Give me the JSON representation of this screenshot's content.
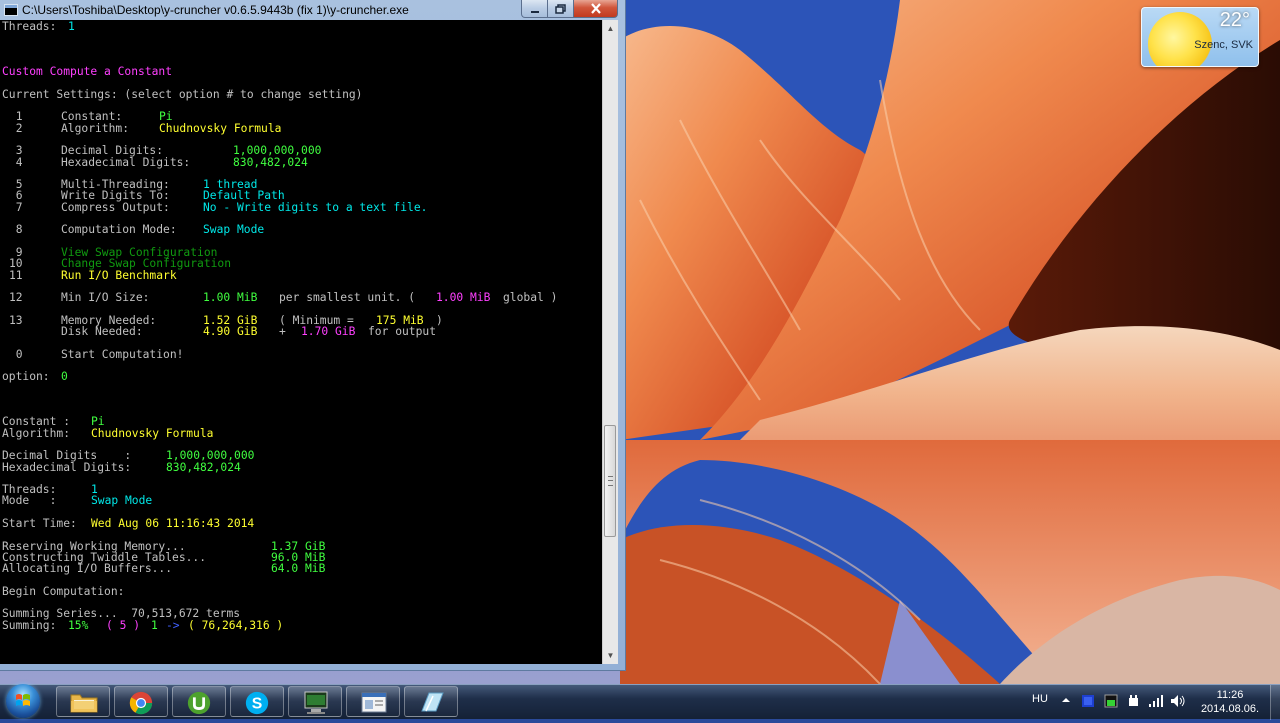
{
  "window": {
    "title": "C:\\Users\\Toshiba\\Desktop\\y-cruncher v0.6.5.9443b (fix 1)\\y-cruncher.exe",
    "minimize_icon": "minimize-icon",
    "maximize_icon": "maximize-icon",
    "close_icon": "close-icon"
  },
  "console": {
    "threads_top": "Threads: ",
    "threads_top_val": "1",
    "menu_title": "Custom Compute a Constant",
    "current_settings": "Current Settings: (select option # to change setting)",
    "opt1": {
      "num": " 1",
      "label": "Constant:",
      "value": "Pi"
    },
    "opt2": {
      "num": " 2",
      "label": "Algorithm:",
      "value": "Chudnovsky Formula"
    },
    "opt3": {
      "num": " 3",
      "label": "Decimal Digits:",
      "value": "1,000,000,000"
    },
    "opt4": {
      "num": " 4",
      "label": "Hexadecimal Digits:",
      "value": "830,482,024"
    },
    "opt5": {
      "num": " 5",
      "label": "Multi-Threading:",
      "value": "1 thread"
    },
    "opt6": {
      "num": " 6",
      "label": "Write Digits To:",
      "value": "Default Path"
    },
    "opt7": {
      "num": " 7",
      "label": "Compress Output:",
      "value": "No - Write digits to a text file."
    },
    "opt8": {
      "num": " 8",
      "label": "Computation Mode:",
      "value": "Swap Mode"
    },
    "opt9": {
      "num": " 9",
      "label": "View Swap Configuration"
    },
    "opt10": {
      "num": "10",
      "label": "Change Swap Configuration"
    },
    "opt11": {
      "num": "11",
      "label": "Run I/O Benchmark"
    },
    "opt12": {
      "num": "12",
      "label": "Min I/O Size:",
      "value": "1.00 MiB",
      "mid": "per smallest unit. (",
      "global_val": "1.00 MiB",
      "global_txt": "global )"
    },
    "opt13": {
      "num": "13",
      "label": "Memory Needed:",
      "value": "1.52 GiB",
      "min_open": "( Minimum =",
      "min_val": "175 MiB",
      "min_close": ")"
    },
    "disk": {
      "label": "Disk Needed:",
      "value": "4.90 GiB",
      "plus": "+",
      "out_val": "1.70 GiB",
      "out_txt": "for output"
    },
    "opt0": {
      "num": " 0",
      "label": "Start Computation!"
    },
    "option_prompt": "option: ",
    "option_val": "0",
    "constant_lbl": "Constant :",
    "constant_val": "Pi",
    "algorithm_lbl": "Algorithm:",
    "algorithm_val": "Chudnovsky Formula",
    "dec_lbl": "Decimal Digits    :",
    "dec_val": "1,000,000,000",
    "hex_lbl": "Hexadecimal Digits:",
    "hex_val": "830,482,024",
    "threads_lbl": "Threads:",
    "threads_val": "1",
    "mode_lbl": "Mode   :",
    "mode_val": "Swap Mode",
    "start_lbl": "Start Time: ",
    "start_val": "Wed Aug 06 11:16:43 2014",
    "reserve_lbl": "Reserving Working Memory...",
    "reserve_val": "1.37 GiB",
    "twiddle_lbl": "Constructing Twiddle Tables...",
    "twiddle_val": "96.0 MiB",
    "buffers_lbl": "Allocating I/O Buffers...",
    "buffers_val": "64.0 MiB",
    "begin": "Begin Computation:",
    "summing_series": "Summing Series...  70,513,672 terms",
    "summing_lbl": "Summing: ",
    "summing_pct": "15%",
    "summing_a": "( 5 )",
    "summing_b": "1",
    "summing_arrow": "->",
    "summing_c": "( 76,264,316 )"
  },
  "weather": {
    "temperature": "22°",
    "location": "Szenc, SVK"
  },
  "taskbar": {
    "start_icon": "windows-start-icon",
    "apps": [
      {
        "name": "explorer",
        "icon": "folder-icon"
      },
      {
        "name": "chrome",
        "icon": "chrome-icon"
      },
      {
        "name": "utorrent",
        "icon": "utorrent-icon"
      },
      {
        "name": "skype",
        "icon": "skype-icon"
      },
      {
        "name": "cmd",
        "icon": "command-prompt-icon"
      },
      {
        "name": "window",
        "icon": "window-app-icon"
      },
      {
        "name": "notes",
        "icon": "notes-icon"
      }
    ],
    "language": "HU",
    "time": "11:26",
    "date": "2014.08.06."
  }
}
